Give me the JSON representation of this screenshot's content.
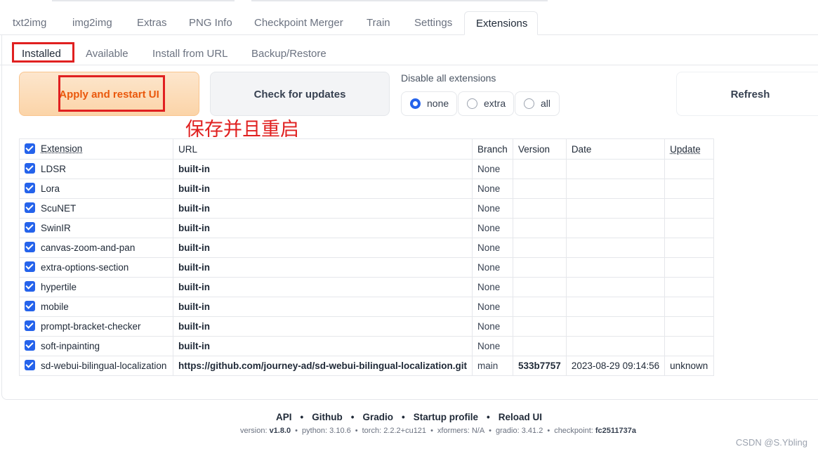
{
  "main_tabs": [
    "txt2img",
    "img2img",
    "Extras",
    "PNG Info",
    "Checkpoint Merger",
    "Train",
    "Settings",
    "Extensions"
  ],
  "sub_tabs": [
    "Installed",
    "Available",
    "Install from URL",
    "Backup/Restore"
  ],
  "buttons": {
    "apply": "Apply and restart UI",
    "check": "Check for updates",
    "refresh": "Refresh"
  },
  "disable": {
    "label": "Disable all extensions",
    "options": [
      "none",
      "extra",
      "all"
    ],
    "selected": "none"
  },
  "annotation": "保存并且重启",
  "table": {
    "headers": [
      "Extension",
      "URL",
      "Branch",
      "Version",
      "Date",
      "Update"
    ],
    "rows": [
      {
        "name": "LDSR",
        "url": "built-in",
        "branch": "None",
        "version": "",
        "date": "",
        "update": ""
      },
      {
        "name": "Lora",
        "url": "built-in",
        "branch": "None",
        "version": "",
        "date": "",
        "update": ""
      },
      {
        "name": "ScuNET",
        "url": "built-in",
        "branch": "None",
        "version": "",
        "date": "",
        "update": ""
      },
      {
        "name": "SwinIR",
        "url": "built-in",
        "branch": "None",
        "version": "",
        "date": "",
        "update": ""
      },
      {
        "name": "canvas-zoom-and-pan",
        "url": "built-in",
        "branch": "None",
        "version": "",
        "date": "",
        "update": ""
      },
      {
        "name": "extra-options-section",
        "url": "built-in",
        "branch": "None",
        "version": "",
        "date": "",
        "update": ""
      },
      {
        "name": "hypertile",
        "url": "built-in",
        "branch": "None",
        "version": "",
        "date": "",
        "update": ""
      },
      {
        "name": "mobile",
        "url": "built-in",
        "branch": "None",
        "version": "",
        "date": "",
        "update": ""
      },
      {
        "name": "prompt-bracket-checker",
        "url": "built-in",
        "branch": "None",
        "version": "",
        "date": "",
        "update": ""
      },
      {
        "name": "soft-inpainting",
        "url": "built-in",
        "branch": "None",
        "version": "",
        "date": "",
        "update": ""
      },
      {
        "name": "sd-webui-bilingual-localization",
        "url": "https://github.com/journey-ad/sd-webui-bilingual-localization.git",
        "branch": "main",
        "version": "533b7757",
        "date": "2023-08-29 09:14:56",
        "update": "unknown"
      }
    ]
  },
  "footer": {
    "links": [
      "API",
      "Github",
      "Gradio",
      "Startup profile",
      "Reload UI"
    ],
    "versions": [
      {
        "label": "version: ",
        "value": "v1.8.0",
        "bold": true
      },
      {
        "label": "python: ",
        "value": "3.10.6",
        "bold": false
      },
      {
        "label": "torch: ",
        "value": "2.2.2+cu121",
        "bold": false
      },
      {
        "label": "xformers: ",
        "value": "N/A",
        "bold": false
      },
      {
        "label": "gradio: ",
        "value": "3.41.2",
        "bold": false
      },
      {
        "label": "checkpoint: ",
        "value": "fc2511737a",
        "bold": true
      }
    ]
  },
  "watermark": "CSDN @S.Ybling",
  "colors": {
    "accent": "#2563eb",
    "primary_text": "#ea580c",
    "annotation": "#e02020"
  }
}
